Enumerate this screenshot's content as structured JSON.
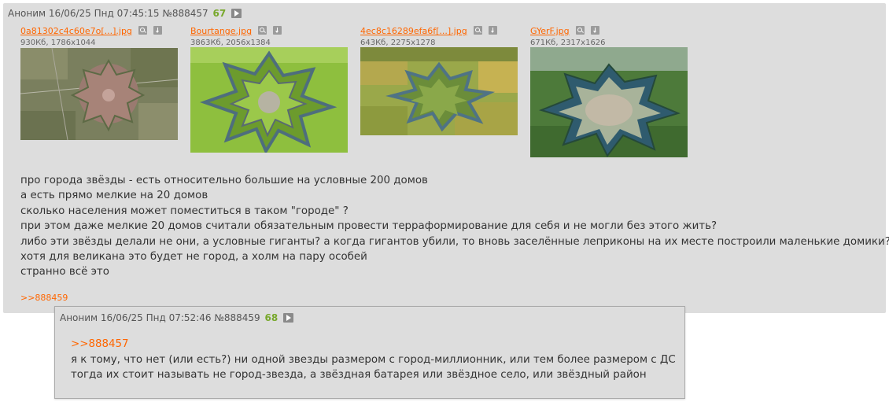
{
  "post": {
    "author": "Аноним",
    "datetime": "16/06/25 Пнд 07:45:15",
    "number": "№888457",
    "count": "67",
    "files": [
      {
        "name": "0a81302c4c60e7o[...].jpg",
        "meta": "930Кб, 1786x1044"
      },
      {
        "name": "Bourtange.jpg",
        "meta": "3863Кб, 2056x1384"
      },
      {
        "name": "4ec8c16289efa6f[...].jpg",
        "meta": "643Кб, 2275x1278"
      },
      {
        "name": "GYerF.jpg",
        "meta": "671Кб, 2317x1626"
      }
    ],
    "lines": [
      "про города звёзды - есть относительно большие на условные 200 домов",
      "а есть прямо мелкие на 20 домов",
      "сколько населения может поместиться в таком \"городе\" ?",
      "при этом даже мелкие 20 домов считали обязательным провести терраформирование для себя и не могли без этого жить?",
      "либо эти звёзды делали не они, а условные гиганты? а когда гигантов убили, то вновь заселённые леприконы на их месте построили маленькие домики?",
      "хотя для великана это будет не город, а холм на пару особей",
      "странно всё это"
    ],
    "reply": ">>888459"
  },
  "popup": {
    "author": "Аноним",
    "datetime": "16/06/25 Пнд 07:52:46",
    "number": "№888459",
    "count": "68",
    "quote_link": ">>888457",
    "lines": [
      "я к тому, что нет (или есть?) ни одной звезды размером с город-миллионник, или тем более размером с ДС",
      "тогда их стоит называть не город-звезда, а звёздная батарея или звёздное село, или звёздный район"
    ]
  },
  "icons": {
    "search": "search-icon",
    "download": "download-icon",
    "play": "play-icon"
  },
  "colors": {
    "link": "#ff6600",
    "count": "#78a82c",
    "post_bg": "#dddddd"
  }
}
